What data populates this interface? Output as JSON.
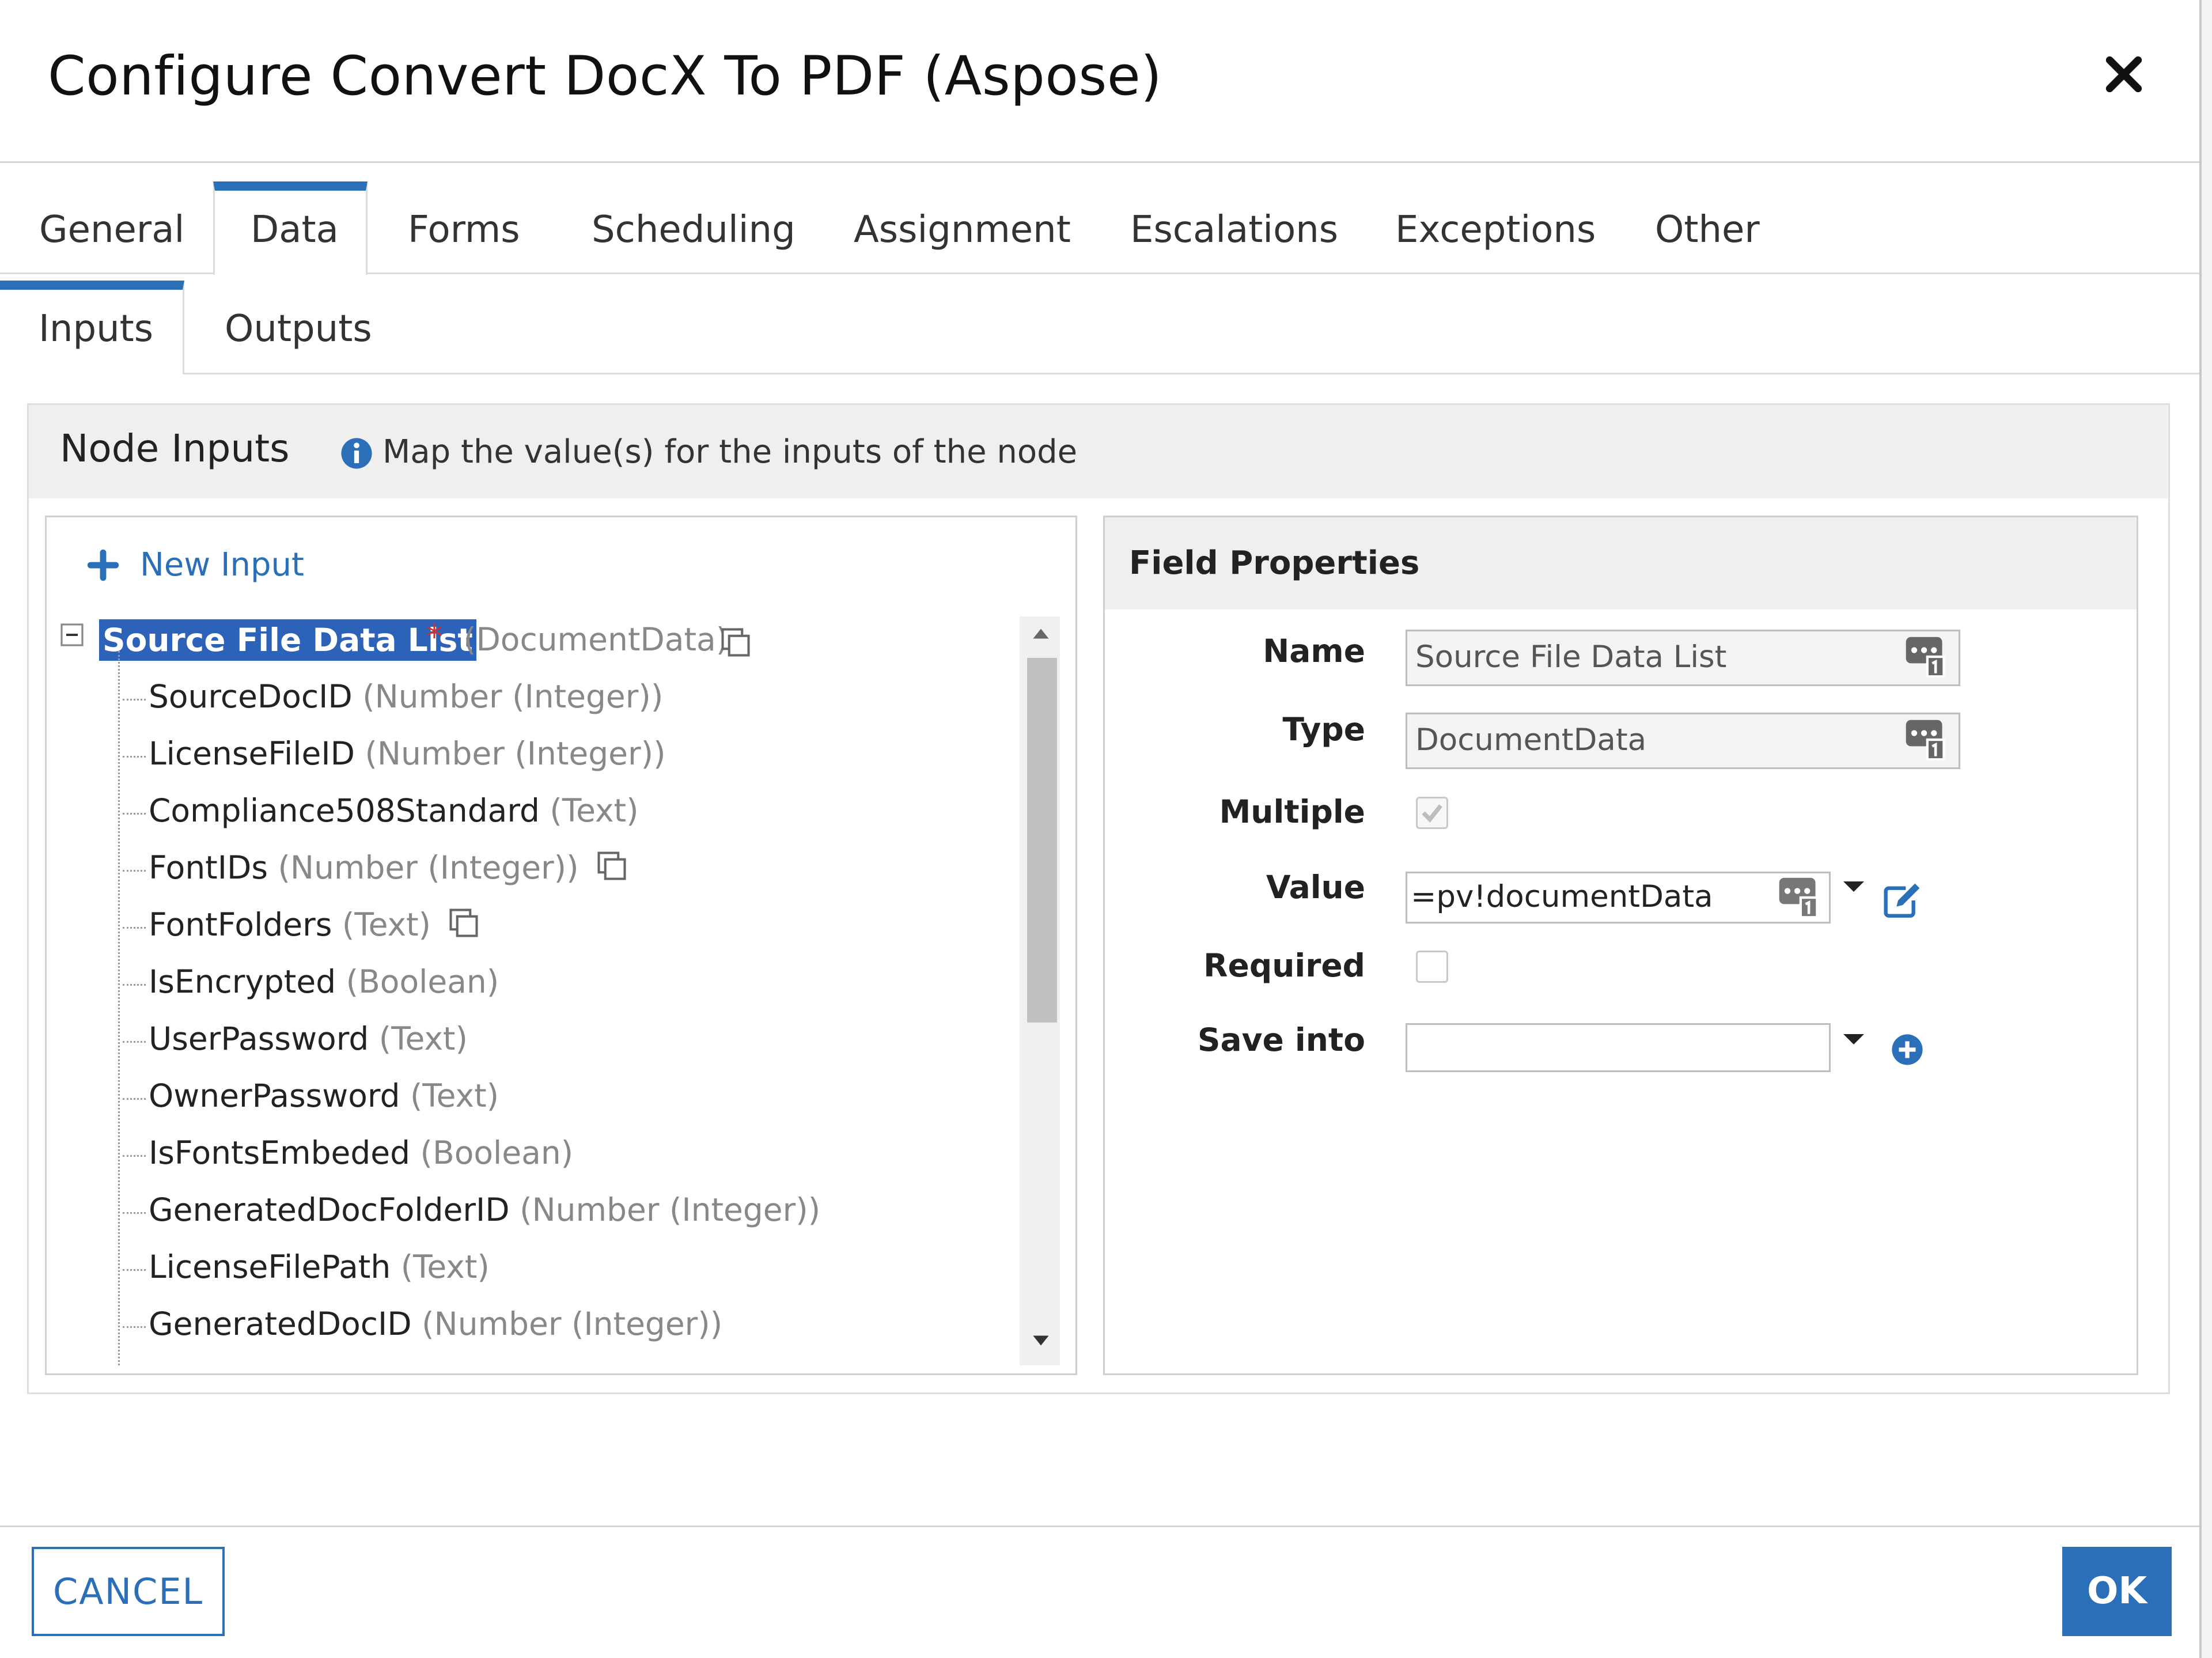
{
  "dialog": {
    "title": "Configure Convert DocX To PDF (Aspose)",
    "close_icon": "close-icon"
  },
  "tabs": [
    {
      "label": "General"
    },
    {
      "label": "Data",
      "active": true
    },
    {
      "label": "Forms"
    },
    {
      "label": "Scheduling"
    },
    {
      "label": "Assignment"
    },
    {
      "label": "Escalations"
    },
    {
      "label": "Exceptions"
    },
    {
      "label": "Other"
    }
  ],
  "subtabs": [
    {
      "label": "Inputs",
      "active": true
    },
    {
      "label": "Outputs"
    }
  ],
  "node_inputs": {
    "title": "Node Inputs",
    "description": "Map the value(s) for the inputs of the node",
    "new_input_label": "New Input",
    "root": {
      "label": "Source File Data List",
      "required_mark": "*",
      "type": "(DocumentData)"
    },
    "children": [
      {
        "name": "SourceDocID",
        "type": "(Number (Integer))"
      },
      {
        "name": "LicenseFileID",
        "type": "(Number (Integer))"
      },
      {
        "name": "Compliance508Standard",
        "type": "(Text)"
      },
      {
        "name": "FontIDs",
        "type": "(Number (Integer))",
        "multiple": true
      },
      {
        "name": "FontFolders",
        "type": "(Text)",
        "multiple": true
      },
      {
        "name": "IsEncrypted",
        "type": "(Boolean)"
      },
      {
        "name": "UserPassword",
        "type": "(Text)"
      },
      {
        "name": "OwnerPassword",
        "type": "(Text)"
      },
      {
        "name": "IsFontsEmbeded",
        "type": "(Boolean)"
      },
      {
        "name": "GeneratedDocFolderID",
        "type": "(Number (Integer))"
      },
      {
        "name": "LicenseFilePath",
        "type": "(Text)"
      },
      {
        "name": "GeneratedDocID",
        "type": "(Number (Integer))"
      }
    ]
  },
  "field_properties": {
    "title": "Field Properties",
    "name_label": "Name",
    "name_value": "Source File Data List",
    "type_label": "Type",
    "type_value": "DocumentData",
    "multiple_label": "Multiple",
    "multiple_checked": true,
    "value_label": "Value",
    "value_value": "=pv!documentData",
    "required_label": "Required",
    "required_checked": false,
    "save_into_label": "Save into",
    "save_into_value": ""
  },
  "footer": {
    "cancel_label": "CANCEL",
    "ok_label": "OK"
  },
  "colors": {
    "accent": "#2a6fb7",
    "selection": "#2c62b8",
    "required": "#d03030"
  }
}
